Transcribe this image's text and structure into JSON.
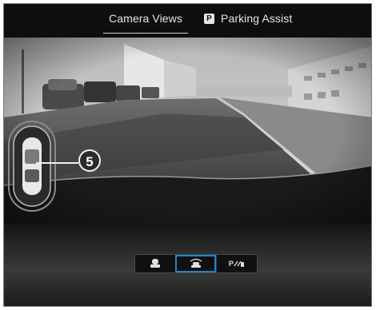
{
  "tabs": {
    "camera_views": "Camera Views",
    "parking_assist_badge": "P",
    "parking_assist": "Parking Assist"
  },
  "callout": {
    "number": "5"
  },
  "controls": {
    "buttons": [
      {
        "icon": "rear-camera-icon",
        "active": false
      },
      {
        "icon": "surround-camera-icon",
        "active": true
      },
      {
        "icon": "parking-assist-icon",
        "label": "P",
        "active": false
      }
    ]
  },
  "colors": {
    "accent": "#1f86c7",
    "background": "#0b0b0b",
    "text": "#e6e6e6"
  }
}
